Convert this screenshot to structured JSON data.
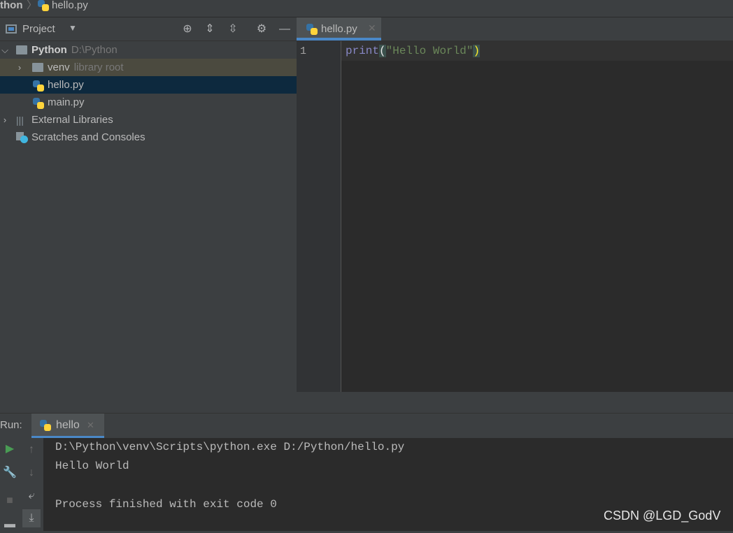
{
  "breadcrumb": {
    "project": "thon",
    "file": "hello.py"
  },
  "project_panel": {
    "title": "Project",
    "tree": [
      {
        "label": "Python",
        "sub": "D:\\Python"
      },
      {
        "label": "venv",
        "sub": "library root"
      },
      {
        "label": "hello.py"
      },
      {
        "label": "main.py"
      },
      {
        "label": "External Libraries"
      },
      {
        "label": "Scratches and Consoles"
      }
    ]
  },
  "editor": {
    "tab": "hello.py",
    "line_number": "1",
    "code": {
      "func": "print",
      "open": "(",
      "string": "\"Hello World\"",
      "close": ")"
    }
  },
  "run": {
    "label": "Run:",
    "tab": "hello",
    "output": [
      "D:\\Python\\venv\\Scripts\\python.exe D:/Python/hello.py",
      "Hello World",
      "",
      "Process finished with exit code 0"
    ]
  },
  "watermark": "CSDN @LGD_GodV",
  "colors": {
    "selection": "#0d293e",
    "venv_row": "#4b4a3f",
    "accent": "#4a88c7",
    "keyword": "#8888c6",
    "string": "#6a8759"
  }
}
